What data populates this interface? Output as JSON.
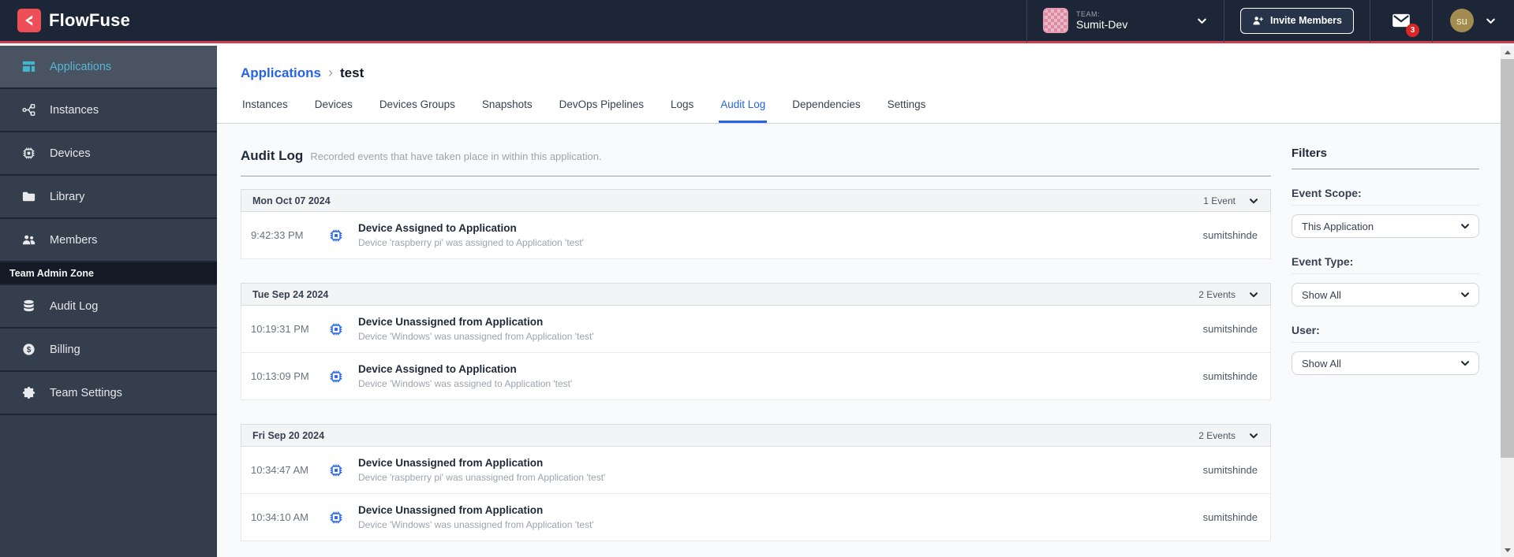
{
  "brand": {
    "name": "FlowFuse"
  },
  "navbar": {
    "team": {
      "label": "TEAM:",
      "name": "Sumit-Dev"
    },
    "invite_button_label": "Invite Members",
    "notifications_count": "3",
    "avatar_initials": "su"
  },
  "sidebar": {
    "items": [
      {
        "label": "Applications",
        "icon": "applications-icon",
        "active": true
      },
      {
        "label": "Instances",
        "icon": "instances-icon",
        "active": false
      },
      {
        "label": "Devices",
        "icon": "devices-icon",
        "active": false
      },
      {
        "label": "Library",
        "icon": "library-icon",
        "active": false
      },
      {
        "label": "Members",
        "icon": "members-icon",
        "active": false
      }
    ],
    "admin_zone_label": "Team Admin Zone",
    "admin_items": [
      {
        "label": "Audit Log",
        "icon": "audit-log-icon",
        "active": false
      },
      {
        "label": "Billing",
        "icon": "billing-icon",
        "active": false
      },
      {
        "label": "Team Settings",
        "icon": "settings-icon",
        "active": false
      }
    ]
  },
  "breadcrumb": {
    "parent": "Applications",
    "separator": "›",
    "current": "test"
  },
  "tabs": [
    {
      "label": "Instances",
      "active": false
    },
    {
      "label": "Devices",
      "active": false
    },
    {
      "label": "Devices Groups",
      "active": false
    },
    {
      "label": "Snapshots",
      "active": false
    },
    {
      "label": "DevOps Pipelines",
      "active": false
    },
    {
      "label": "Logs",
      "active": false
    },
    {
      "label": "Audit Log",
      "active": true
    },
    {
      "label": "Dependencies",
      "active": false
    },
    {
      "label": "Settings",
      "active": false
    }
  ],
  "page": {
    "title": "Audit Log",
    "subtitle": "Recorded events that have taken place in within this application."
  },
  "audit": {
    "groups": [
      {
        "date": "Mon Oct 07 2024",
        "count_label": "1 Event",
        "events": [
          {
            "time": "9:42:33 PM",
            "icon": "device-chip-icon",
            "title": "Device Assigned to Application",
            "detail": "Device 'raspberry pi' was assigned to Application 'test'",
            "user": "sumitshinde"
          }
        ]
      },
      {
        "date": "Tue Sep 24 2024",
        "count_label": "2 Events",
        "events": [
          {
            "time": "10:19:31 PM",
            "icon": "device-chip-icon",
            "title": "Device Unassigned from Application",
            "detail": "Device 'Windows' was unassigned from Application 'test'",
            "user": "sumitshinde"
          },
          {
            "time": "10:13:09 PM",
            "icon": "device-chip-icon",
            "title": "Device Assigned to Application",
            "detail": "Device 'Windows' was assigned to Application 'test'",
            "user": "sumitshinde"
          }
        ]
      },
      {
        "date": "Fri Sep 20 2024",
        "count_label": "2 Events",
        "events": [
          {
            "time": "10:34:47 AM",
            "icon": "device-chip-icon",
            "title": "Device Unassigned from Application",
            "detail": "Device 'raspberry pi' was unassigned from Application 'test'",
            "user": "sumitshinde"
          },
          {
            "time": "10:34:10 AM",
            "icon": "device-chip-icon",
            "title": "Device Unassigned from Application",
            "detail": "Device 'Windows' was unassigned from Application 'test'",
            "user": "sumitshinde"
          }
        ]
      }
    ]
  },
  "filters": {
    "title": "Filters",
    "sections": [
      {
        "label": "Event Scope:",
        "value": "This Application"
      },
      {
        "label": "Event Type:",
        "value": "Show All"
      },
      {
        "label": "User:",
        "value": "Show All"
      }
    ]
  },
  "colors": {
    "navbar_bg": "#1c2636",
    "accent_red": "#cf3d50",
    "logo_red": "#ee4e55",
    "sidebar_item_bg": "#353e4d",
    "sidebar_active_bg": "#495362",
    "active_teal": "#44b5cb",
    "link_blue": "#2563eb",
    "badge_red": "#dc2626",
    "avatar_gold": "#a28c50",
    "content_bg": "#f9fafb"
  }
}
